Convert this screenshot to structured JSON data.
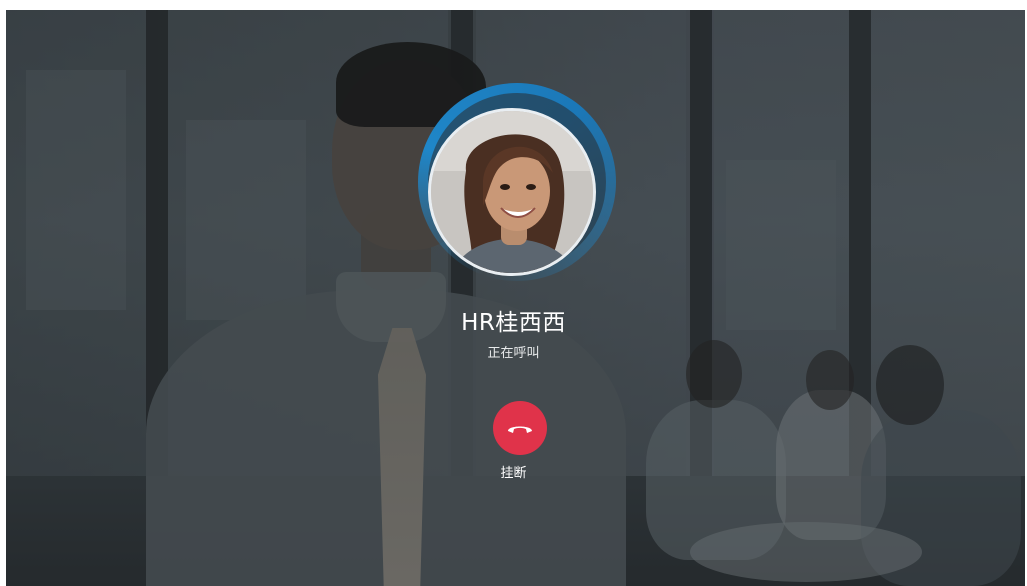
{
  "call": {
    "caller_name": "HR桂西西",
    "status": "正在呼叫",
    "hangup_label": "挂断"
  },
  "icons": {
    "hangup": "phone-hangup-icon",
    "avatar": "caller-avatar"
  },
  "colors": {
    "hangup_button": "#e0334a",
    "avatar_ring": "#1f86c8",
    "text": "#ffffff"
  }
}
